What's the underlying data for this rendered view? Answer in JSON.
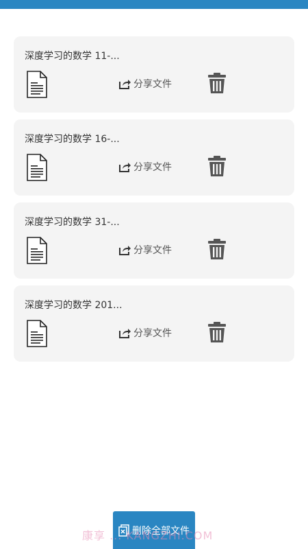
{
  "colors": {
    "accent": "#2a86c2",
    "card_bg": "#f4f4f4",
    "icon_gray": "#555555"
  },
  "files": [
    {
      "title": "深度学习的数学 11-...",
      "share_label": "分享文件",
      "file_icon": "document-icon",
      "share_icon": "share-icon",
      "delete_icon": "trash-icon"
    },
    {
      "title": "深度学习的数学 16-...",
      "share_label": "分享文件",
      "file_icon": "document-icon",
      "share_icon": "share-icon",
      "delete_icon": "trash-icon"
    },
    {
      "title": "深度学习的数学 31-...",
      "share_label": "分享文件",
      "file_icon": "document-icon",
      "share_icon": "share-icon",
      "delete_icon": "trash-icon"
    },
    {
      "title": "深度学习的数学 201...",
      "share_label": "分享文件",
      "file_icon": "document-icon",
      "share_icon": "share-icon",
      "delete_icon": "trash-icon"
    }
  ],
  "bottom": {
    "delete_all_label": "删除全部文件",
    "icon": "delete-all-icon"
  },
  "watermark": {
    "text": "康享 ... KANGZHI.COM"
  }
}
